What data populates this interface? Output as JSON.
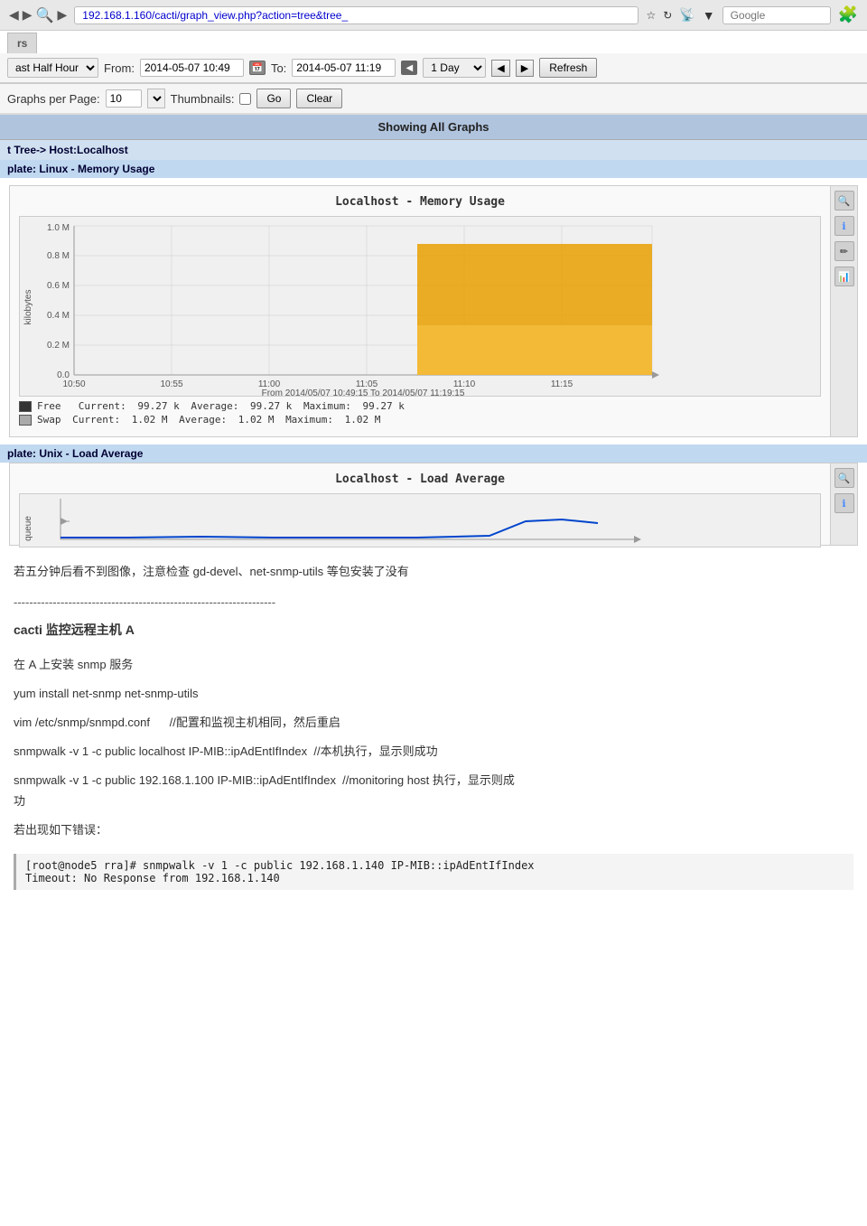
{
  "browser": {
    "url": "192.168.1.160/cacti/graph_view.php?action=tree&tree_",
    "search_placeholder": "Google",
    "nav_back": "◀",
    "nav_forward": "▶",
    "nav_refresh": "↻"
  },
  "toolbar": {
    "tab_label": "rs",
    "preset_label": "ast Half Hour",
    "from_label": "From:",
    "from_value": "2014-05-07 10:49",
    "to_label": "To:",
    "to_value": "2014-05-07 11:19",
    "timespan_label": "1 Day",
    "refresh_label": "Refresh",
    "graphs_per_page_label": "Graphs per Page:",
    "graphs_per_page_value": "10",
    "thumbnails_label": "Thumbnails:",
    "go_label": "Go",
    "clear_label": "Clear"
  },
  "main": {
    "showing_all_graphs": "Showing All Graphs",
    "tree_path": "t Tree-> Host:Localhost",
    "template1_label": "plate: Linux - Memory Usage",
    "graph1": {
      "title": "Localhost - Memory Usage",
      "x_labels": [
        "10:50",
        "10:55",
        "11:00",
        "11:05",
        "11:10",
        "11:15"
      ],
      "y_labels": [
        "0.0",
        "0.2 M",
        "0.4 M",
        "0.6 M",
        "0.8 M",
        "1.0 M"
      ],
      "y_axis_label": "kilobytes",
      "time_range": "From 2014/05/07 10:49:15 To 2014/05/07 11:19:15",
      "legend": [
        {
          "color": "#333",
          "label": "Free",
          "current": "99.27 k",
          "average": "99.27 k",
          "maximum": "99.27 k"
        },
        {
          "color": "#888",
          "label": "Swap",
          "current": "1.02 M",
          "average": "1.02 M",
          "maximum": "1.02 M"
        }
      ]
    },
    "template2_label": "plate: Unix - Load Average",
    "graph2": {
      "title": "Localhost - Load Average",
      "y_axis_label": "queue"
    }
  },
  "content": {
    "notice": "若五分钟后看不到图像，注意检查 gd-devel、net-snmp-utils 等包安装了没有",
    "separator": "-------------------------------------------------------------------",
    "section_title": "cacti 监控远程主机 A",
    "steps": [
      "在 A 上安装 snmp 服务",
      "yum install net-snmp net-snmp-utils",
      "vim /etc/snmp/snmpd.conf      //配置和监视主机相同，然后重启",
      "snmpwalk -v 1 -c public localhost IP-MIB::ipAdEntIfIndex  //本机执行，显示则成功",
      "snmpwalk -v 1 -c public 192.168.1.100 IP-MIB::ipAdEntIfIndex  //monitoring host 执行，显示则成功",
      "若出现如下错误："
    ],
    "code_block": "[root@node5 rra]# snmpwalk -v 1 -c public 192.168.1.140 IP-MIB::ipAdEntIfIndex\nTimeout: No Response from 192.168.1.140"
  }
}
